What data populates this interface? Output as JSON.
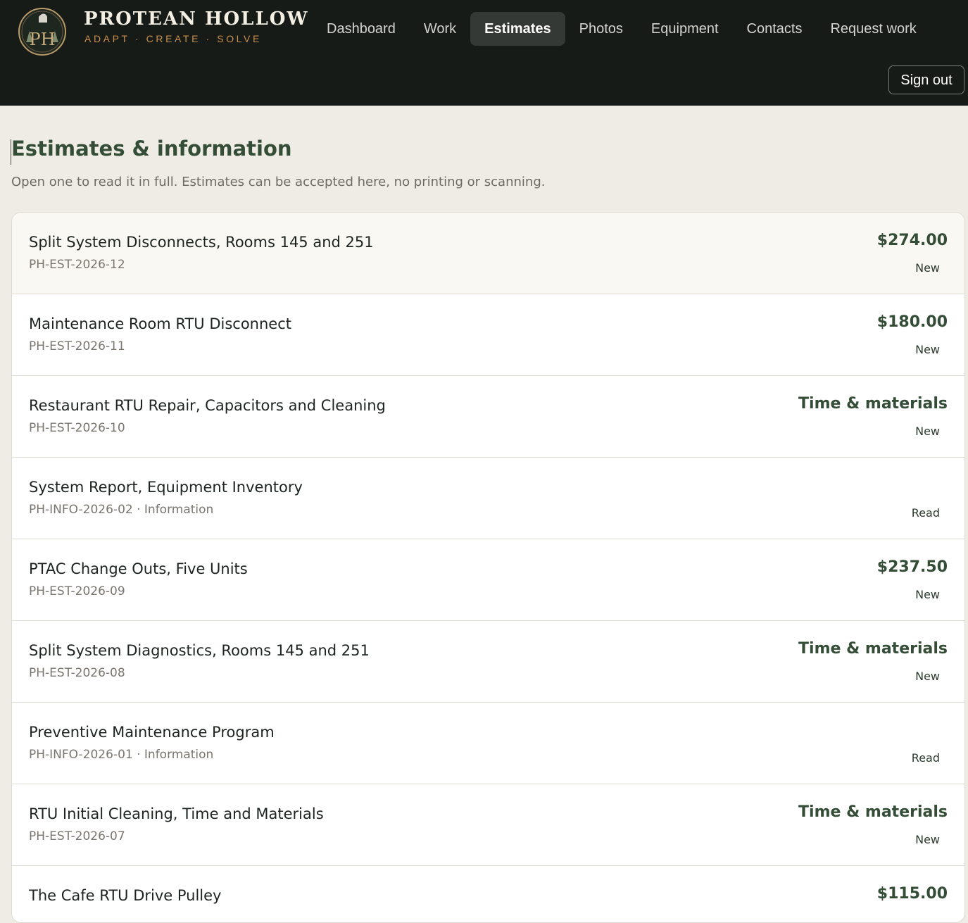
{
  "brand": {
    "name": "PROTEAN HOLLOW",
    "tagline": "ADAPT · CREATE · SOLVE",
    "monogram": "PH",
    "logo_icon": "ph-monogram-crest-icon"
  },
  "nav": {
    "items": [
      {
        "label": "Dashboard",
        "active": false
      },
      {
        "label": "Work",
        "active": false
      },
      {
        "label": "Estimates",
        "active": true
      },
      {
        "label": "Photos",
        "active": false
      },
      {
        "label": "Equipment",
        "active": false
      },
      {
        "label": "Contacts",
        "active": false
      },
      {
        "label": "Request work",
        "active": false
      }
    ],
    "sign_out_label": "Sign out"
  },
  "page": {
    "title": "Estimates & information",
    "subtitle": "Open one to read it in full. Estimates can be accepted here, no printing or scanning."
  },
  "estimates": [
    {
      "title": "Split System Disconnects, Rooms 145 and 251",
      "ref": "PH-EST-2026-12",
      "amount": "$274.00",
      "status": "New"
    },
    {
      "title": "Maintenance Room RTU Disconnect",
      "ref": "PH-EST-2026-11",
      "amount": "$180.00",
      "status": "New"
    },
    {
      "title": "Restaurant RTU Repair, Capacitors and Cleaning",
      "ref": "PH-EST-2026-10",
      "amount": "Time & materials",
      "status": "New"
    },
    {
      "title": "System Report, Equipment Inventory",
      "ref": "PH-INFO-2026-02 · Information",
      "amount": "",
      "status": "Read"
    },
    {
      "title": "PTAC Change Outs, Five Units",
      "ref": "PH-EST-2026-09",
      "amount": "$237.50",
      "status": "New"
    },
    {
      "title": "Split System Diagnostics, Rooms 145 and 251",
      "ref": "PH-EST-2026-08",
      "amount": "Time & materials",
      "status": "New"
    },
    {
      "title": "Preventive Maintenance Program",
      "ref": "PH-INFO-2026-01 · Information",
      "amount": "",
      "status": "Read"
    },
    {
      "title": "RTU Initial Cleaning, Time and Materials",
      "ref": "PH-EST-2026-07",
      "amount": "Time & materials",
      "status": "New"
    },
    {
      "title": "The Cafe RTU Drive Pulley",
      "ref": "",
      "amount": "$115.00",
      "status": ""
    }
  ],
  "colors": {
    "header_bg": "#161b18",
    "accent_green": "#344d36",
    "accent_orange": "#c98f4a",
    "page_bg": "#efece5"
  }
}
